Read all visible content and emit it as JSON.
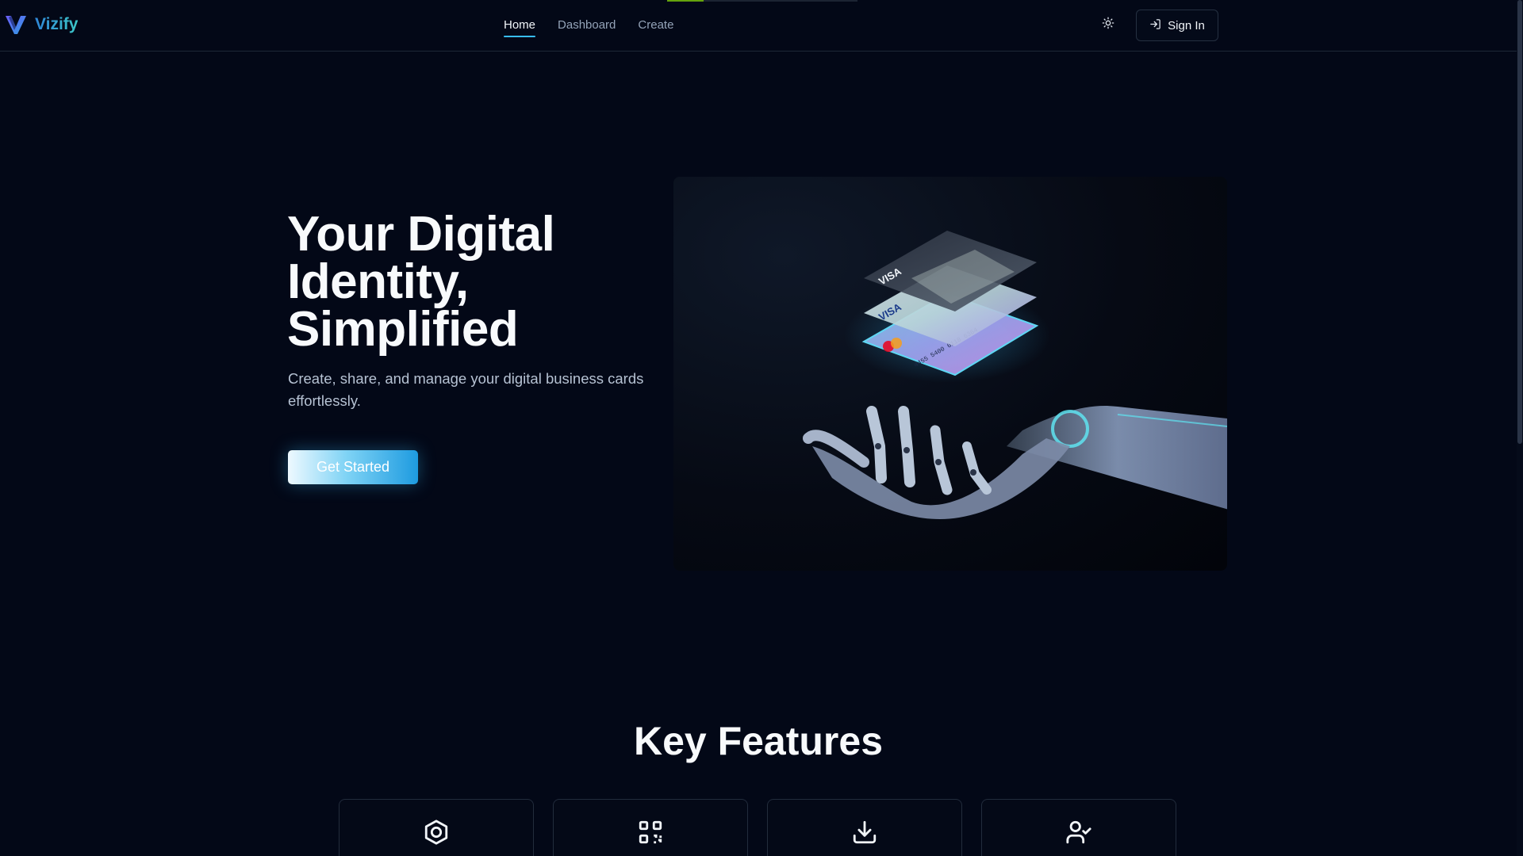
{
  "top_progress": {
    "fraction": 0.19,
    "color": "#65a30d"
  },
  "brand": {
    "name": "Vizify",
    "logo_icon": "v-logo-icon",
    "accent": "#38bdf8"
  },
  "nav": {
    "items": [
      {
        "label": "Home",
        "active": true
      },
      {
        "label": "Dashboard",
        "active": false
      },
      {
        "label": "Create",
        "active": false
      }
    ]
  },
  "header": {
    "theme_toggle_icon": "sun-icon",
    "signin_label": "Sign In",
    "signin_icon": "log-in-icon"
  },
  "hero": {
    "title_line1": "Your Digital",
    "title_line2": "Identity,",
    "title_line3": "Simplified",
    "subtitle": "Create, share, and manage your digital business cards effortlessly.",
    "cta_label": "Get Started",
    "image_subject": "robot-hand-holding-cards",
    "card_brands": [
      "VISA",
      "VISA",
      "mastercard"
    ],
    "card_number": "4455 5400 6118 6364"
  },
  "features": {
    "title": "Key Features",
    "card_icons": [
      "hexagon-icon",
      "qr-code-icon",
      "download-icon",
      "user-check-icon"
    ]
  }
}
